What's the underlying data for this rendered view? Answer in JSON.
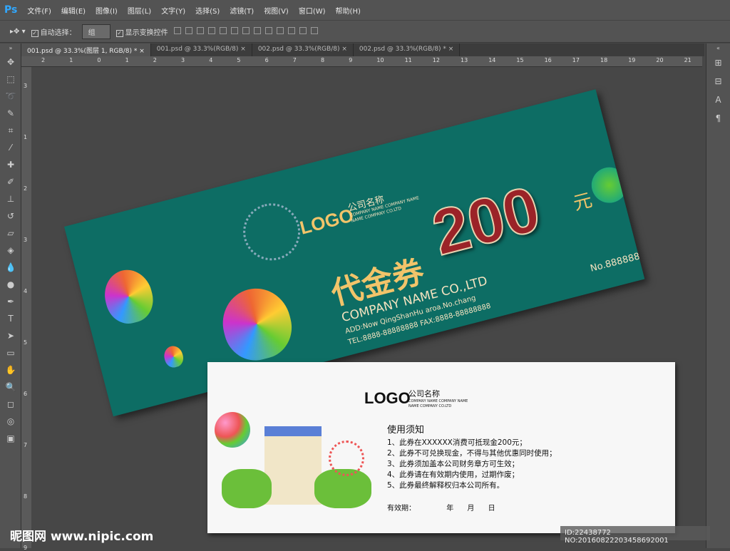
{
  "app": {
    "logo": "Ps"
  },
  "menu": [
    "文件(F)",
    "编辑(E)",
    "图像(I)",
    "图层(L)",
    "文字(Y)",
    "选择(S)",
    "滤镜(T)",
    "视图(V)",
    "窗口(W)",
    "帮助(H)"
  ],
  "options": {
    "auto_select_label": "自动选择：",
    "auto_select_checked": true,
    "auto_select_value": "组",
    "show_transform_label": "显示变换控件",
    "show_transform_checked": true
  },
  "tabs": [
    {
      "label": "001.psd @ 33.3%(图层 1, RGB/8) *",
      "active": true
    },
    {
      "label": "001.psd @ 33.3%(RGB/8)"
    },
    {
      "label": "002.psd @ 33.3%(RGB/8)"
    },
    {
      "label": "002.psd @ 33.3%(RGB/8) *"
    }
  ],
  "ruler_h": [
    "2",
    "1",
    "0",
    "1",
    "2",
    "3",
    "4",
    "5",
    "6",
    "7",
    "8",
    "9",
    "10",
    "11",
    "12",
    "13",
    "14",
    "15",
    "16",
    "17",
    "18",
    "19",
    "20",
    "21"
  ],
  "ruler_v": [
    "3",
    "1",
    "2",
    "3",
    "4",
    "5",
    "6",
    "7",
    "8",
    "9"
  ],
  "voucher_front": {
    "logo": "LOGO",
    "company_cn": "公司名称",
    "company_en1": "COMPANY NAME COMPANY NAME",
    "company_en2": "NAME COMPANY CO.LTD",
    "title": "代金券",
    "amount": "200",
    "unit": "元",
    "company": "COMPANY NAME CO.,LTD",
    "address": "ADD:Now QingShanHu aroa.No.chang",
    "tel": "TEL:8888-88888888  FAX:8888-88888888",
    "number": "No.88888888",
    "bg_color": "#0d6d64",
    "amount_color": "#9b2328"
  },
  "voucher_back": {
    "logo": "LOGO",
    "company_cn": "公司名称",
    "company_en1": "COMPANY NAME COMPANY NAME",
    "company_en2": "NAME COMPANY CO.LTD",
    "heading": "使用须知",
    "rules": [
      "1、此券在XXXXXX消费可抵现金200元；",
      "2、此券不可兑换现金，不得与其他优惠同时使用；",
      "3、此券须加盖本公司财务章方可生效；",
      "4、此券请在有效期内使用，过期作废；",
      "5、此券最终解释权归本公司所有。"
    ],
    "valid_label": "有效期：",
    "year": "年",
    "month": "月",
    "day": "日"
  },
  "watermark": "昵图网 www.nipic.com",
  "id_tag": "ID:22438772 NO:20160822203458692001"
}
